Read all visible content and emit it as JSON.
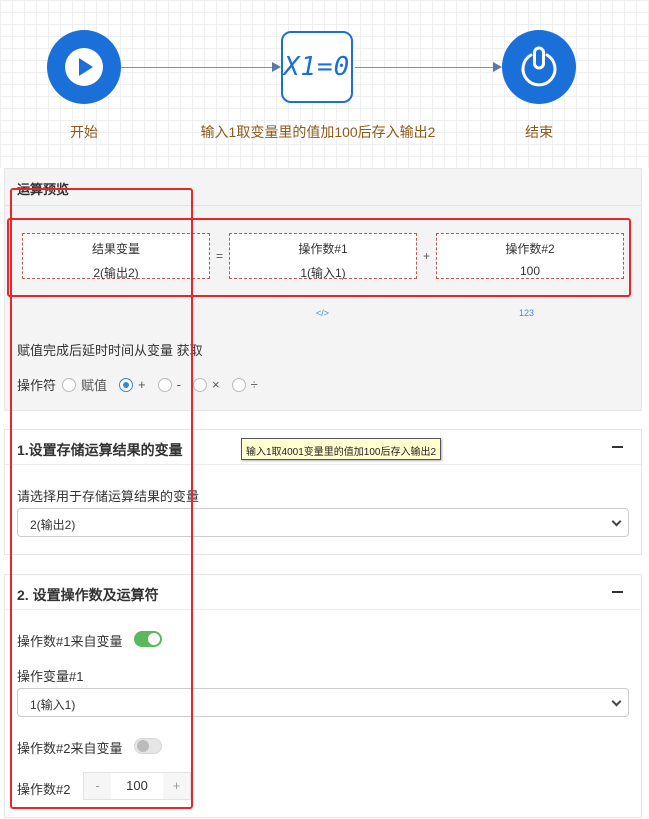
{
  "flow": {
    "start_label": "开始",
    "process_label": "输入1取变量里的值加100后存入输出2",
    "process_icon_text": "X1=0",
    "end_label": "结束"
  },
  "preview": {
    "title": "运算预览",
    "result": {
      "title": "结果变量",
      "value": "2(输出2)"
    },
    "eq_sym": "=",
    "operand1": {
      "title": "操作数#1",
      "value": "1(输入1)"
    },
    "plus_sym": "+",
    "operand2": {
      "title": "操作数#2",
      "value": "100"
    },
    "link1": "</>",
    "link2": "123",
    "delay_text": "赋值完成后延时时间从变量 获取",
    "operator_label": "操作符",
    "operators": [
      "赋值",
      "+",
      "-",
      "×",
      "÷"
    ],
    "selected_operator": "+"
  },
  "tooltip": "输入1取4001变量里的值加100后存入输出2",
  "section1": {
    "title": "1.设置存储运算结果的变量",
    "field_label": "请选择用于存储运算结果的变量",
    "select_value": "2(输出2)"
  },
  "section2": {
    "title": "2. 设置操作数及运算符",
    "op1_from_var_label": "操作数#1来自变量",
    "op1_var_label": "操作变量#1",
    "op1_var_value": "1(输入1)",
    "op2_from_var_label": "操作数#2来自变量",
    "op2_label": "操作数#2",
    "op2_value": "100",
    "minus": "-",
    "plus": "+"
  },
  "colors": {
    "primary": "#1b6fd8",
    "annotation_red": "#e8262a",
    "toggle_on": "#5cb85c",
    "label_brown": "#8a5a1a"
  }
}
